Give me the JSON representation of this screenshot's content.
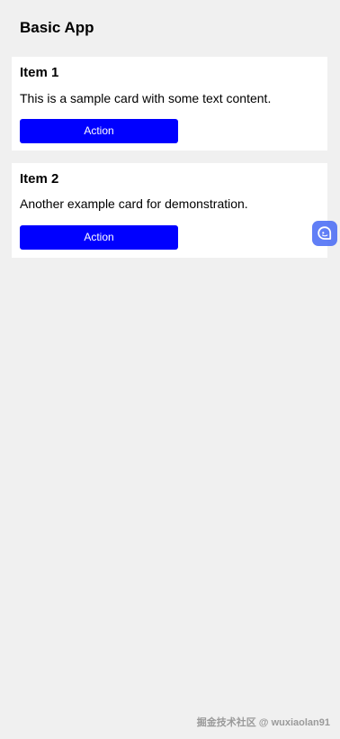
{
  "header": {
    "title": "Basic App"
  },
  "cards": [
    {
      "title": "Item 1",
      "text": "This is a sample card with some text content.",
      "button_label": "Action"
    },
    {
      "title": "Item 2",
      "text": "Another example card for demonstration.",
      "button_label": "Action"
    }
  ],
  "floating_button": {
    "icon": "chat-assistant-icon",
    "color": "#4c6ef5"
  },
  "watermark": {
    "text": "掘金技术社区 @ wuxiaolan91"
  },
  "colors": {
    "background": "#f0f0f0",
    "card": "#ffffff",
    "button": "#0000ff",
    "button_text": "#ffffff"
  }
}
